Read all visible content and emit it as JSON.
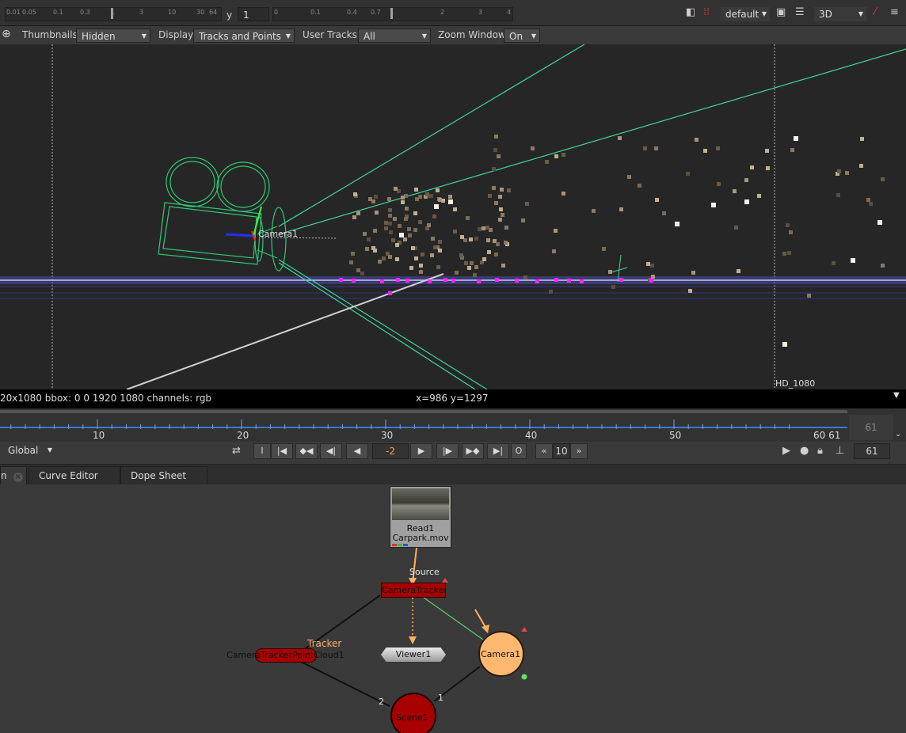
{
  "top": {
    "gain_ticks": [
      "0.01",
      "0.05",
      "0.1",
      "0.3",
      "1",
      "3",
      "10",
      "30",
      "64"
    ],
    "gamma_label": "y",
    "gamma_value": "1",
    "gamma_ticks": [
      "0",
      "0.1",
      "0.4",
      "0.7",
      "1",
      "2",
      "3",
      "4"
    ],
    "viewer_preset": "default",
    "view_mode": "3D"
  },
  "toolbar": {
    "thumbnails_label": "Thumbnails",
    "thumbnails_value": "Hidden",
    "display_label": "Display",
    "display_value": "Tracks and Points",
    "user_tracks_label": "User Tracks",
    "user_tracks_value": "All",
    "zoom_window_label": "Zoom Window",
    "zoom_window_value": "On"
  },
  "viewer": {
    "camera_label": "Camera1",
    "format_label": "HD_1080"
  },
  "info": {
    "format_text": "20x1080  bbox: 0 0 1920 1080 channels: rgb",
    "coords_text": "x=986 y=1297"
  },
  "timeline": {
    "ticks": [
      "10",
      "20",
      "30",
      "40",
      "50",
      "60 61"
    ],
    "end_frame": "61"
  },
  "transport": {
    "scope": "Global",
    "in_label": "I",
    "out_label": "O",
    "current_frame": "-2",
    "step": "10",
    "frame_field": "61"
  },
  "tabs": [
    {
      "label": "Curve Editor"
    },
    {
      "label": "Dope Sheet"
    }
  ],
  "nodes": {
    "read_name": "Read1",
    "read_file": "Carpark.mov",
    "source_label": "Source",
    "tracker_node": "CameraTracker1",
    "tracker_label": "Tracker",
    "pointcloud_node": "CameraTrackerPointCloud1",
    "viewer_node": "Viewer1",
    "camera_node": "Camera1",
    "scene_node": "Scene1",
    "input_2": "2",
    "input_1": "1"
  },
  "colors": {
    "track_green": "#3fd69a",
    "camera_wire": "#30c878",
    "magenta_points": "#ff22ff",
    "tracker_red": "#a80000",
    "camera_orange": "#ffb870"
  }
}
